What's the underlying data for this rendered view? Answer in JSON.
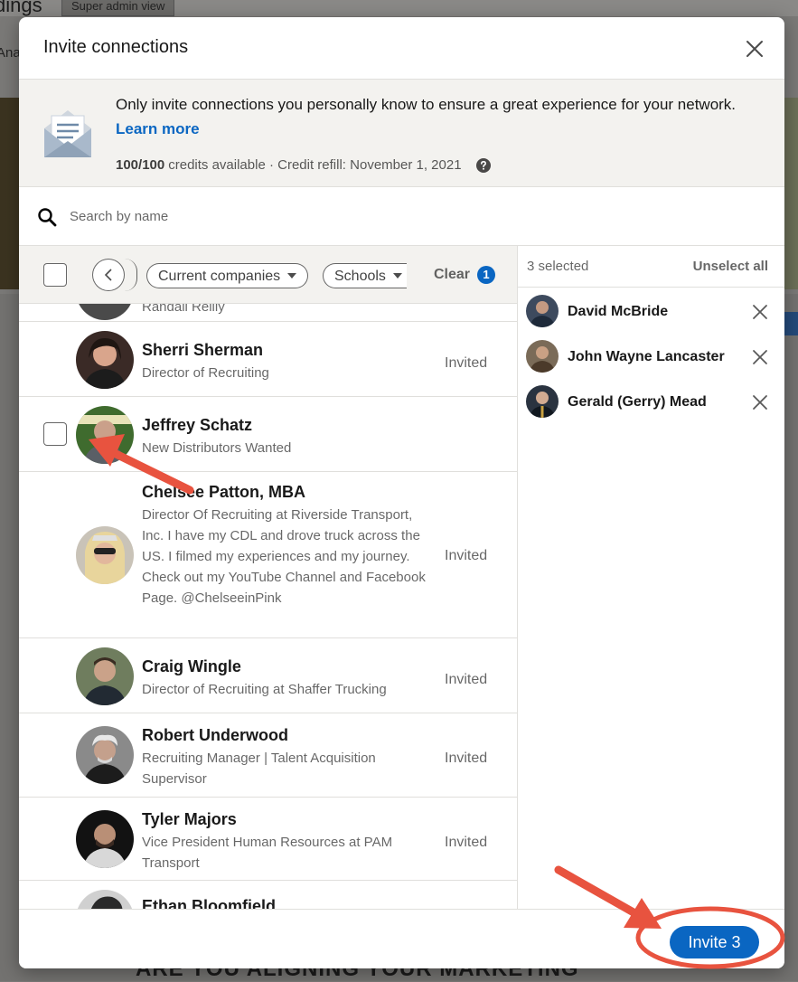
{
  "background": {
    "page_title": "dings",
    "badge": "Super admin view",
    "tab": "Ana",
    "bottom_heading": "ARE YOU ALIGNING YOUR MARKETING"
  },
  "modal": {
    "title": "Invite connections",
    "close_icon": "close-icon",
    "notice": {
      "text": "Only invite connections you personally know to ensure a great experience for your network.",
      "link": "Learn more",
      "credits_bold": "100/100",
      "credits_rest": "credits available · Credit refill: November 1, 2021"
    },
    "search": {
      "placeholder": "Search by name"
    },
    "filters": {
      "companies": "Current companies",
      "schools": "Schools",
      "clear": "Clear",
      "clear_count": "1"
    },
    "list": {
      "partial_top": "Randall Reilly",
      "rows": [
        {
          "name": "Sherri Sherman",
          "headline": "Director of Recruiting",
          "status": "Invited"
        },
        {
          "name": "Jeffrey Schatz",
          "headline": "New Distributors Wanted",
          "status": ""
        },
        {
          "name": "Chelsee Patton, MBA",
          "headline": "Director Of Recruiting at Riverside Transport, Inc. I have my CDL and drove truck across the US. I filmed my experiences and my journey. Check out my YouTube Channel and Facebook Page. @ChelseeinPink",
          "status": "Invited"
        },
        {
          "name": "Craig Wingle",
          "headline": "Director of Recruiting at Shaffer Trucking",
          "status": "Invited"
        },
        {
          "name": "Robert Underwood",
          "headline": "Recruiting Manager | Talent Acquisition Supervisor",
          "status": "Invited"
        },
        {
          "name": "Tyler Majors",
          "headline": "Vice President Human Resources at PAM Transport",
          "status": "Invited"
        },
        {
          "name": "Ethan Bloomfield",
          "headline": "",
          "status": ""
        }
      ]
    },
    "selected": {
      "count_label": "3 selected",
      "unselect_all": "Unselect all",
      "people": [
        {
          "name": "David McBride"
        },
        {
          "name": "John Wayne Lancaster"
        },
        {
          "name": "Gerald (Gerry) Mead"
        }
      ]
    },
    "footer": {
      "invite_button": "Invite 3"
    }
  },
  "colors": {
    "accent": "#0a66c2",
    "annotation": "#e8533f"
  }
}
